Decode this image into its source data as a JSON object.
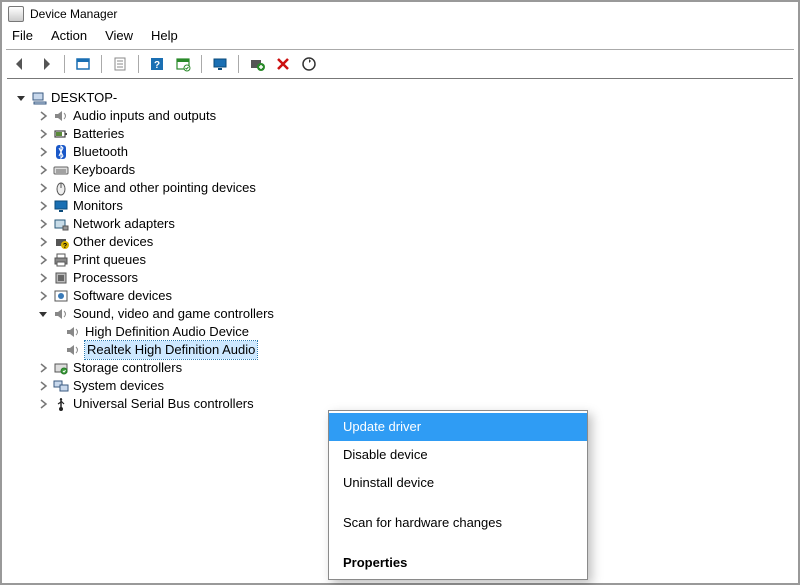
{
  "window": {
    "title": "Device Manager"
  },
  "menu": {
    "file": "File",
    "action": "Action",
    "view": "View",
    "help": "Help"
  },
  "toolbar_icons": {
    "back": "back",
    "forward": "forward",
    "show": "show",
    "properties": "properties",
    "help": "help",
    "update": "update",
    "monitor": "monitor",
    "add": "add",
    "remove": "remove",
    "scan": "scan"
  },
  "tree": {
    "root": {
      "label": "DESKTOP-"
    },
    "items": [
      {
        "label": "Audio inputs and outputs",
        "expanded": false
      },
      {
        "label": "Batteries",
        "expanded": false
      },
      {
        "label": "Bluetooth",
        "expanded": false
      },
      {
        "label": "Keyboards",
        "expanded": false
      },
      {
        "label": "Mice and other pointing devices",
        "expanded": false
      },
      {
        "label": "Monitors",
        "expanded": false
      },
      {
        "label": "Network adapters",
        "expanded": false
      },
      {
        "label": "Other devices",
        "expanded": false
      },
      {
        "label": "Print queues",
        "expanded": false
      },
      {
        "label": "Processors",
        "expanded": false
      },
      {
        "label": "Software devices",
        "expanded": false
      },
      {
        "label": "Sound, video and game controllers",
        "expanded": true
      },
      {
        "label": "Storage controllers",
        "expanded": false
      },
      {
        "label": "System devices",
        "expanded": false
      },
      {
        "label": "Universal Serial Bus controllers",
        "expanded": false
      }
    ],
    "sound_children": [
      {
        "label": "High Definition Audio Device"
      },
      {
        "label": "Realtek High Definition Audio"
      }
    ]
  },
  "context_menu": {
    "update": "Update driver",
    "disable": "Disable device",
    "uninstall": "Uninstall device",
    "scan": "Scan for hardware changes",
    "properties": "Properties"
  }
}
